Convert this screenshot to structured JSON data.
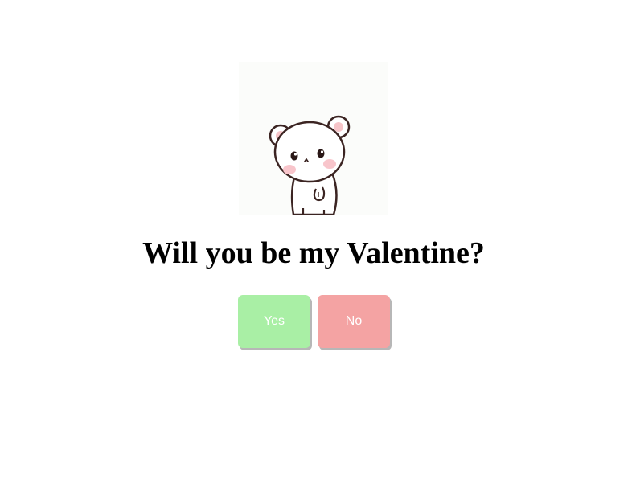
{
  "image": {
    "icon": "bear-icon",
    "background": "#fbfcfa"
  },
  "question": "Will you be my Valentine?",
  "buttons": {
    "yes_label": "Yes",
    "no_label": "No",
    "yes_color": "#a9efa5",
    "no_color": "#f4a3a3"
  }
}
